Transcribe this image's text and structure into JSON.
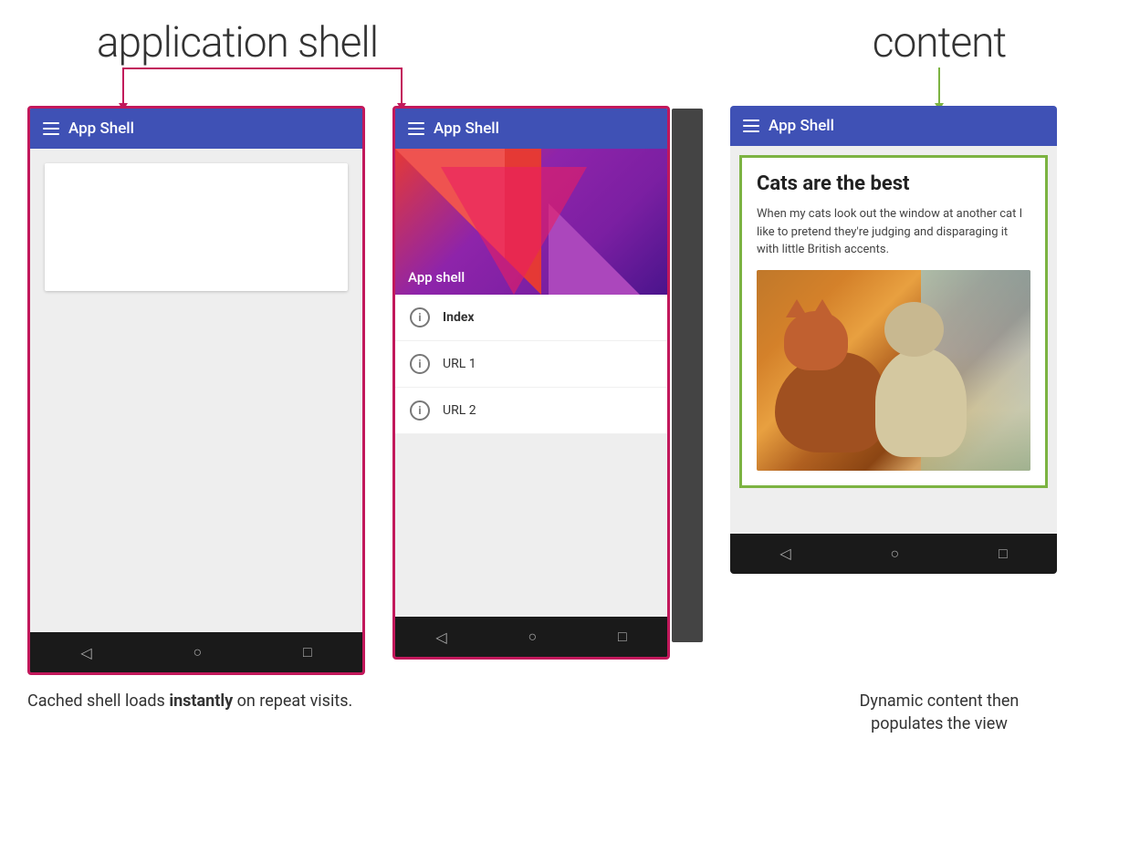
{
  "labels": {
    "application_shell": "application shell",
    "content": "content"
  },
  "phones": {
    "first": {
      "title": "App Shell",
      "placeholder": "content placeholder"
    },
    "second": {
      "title": "App Shell",
      "drawer_app_label": "App shell",
      "menu_items": [
        {
          "label": "Index",
          "bold": true
        },
        {
          "label": "URL 1",
          "bold": false
        },
        {
          "label": "URL 2",
          "bold": false
        }
      ]
    },
    "third": {
      "title": "App Shell",
      "article": {
        "title": "Cats are the best",
        "text": "When my cats look out the window at another cat I like to pretend they're judging and disparaging it with little British accents."
      }
    }
  },
  "nav": {
    "back": "◁",
    "home": "○",
    "recent": "□"
  },
  "captions": {
    "left": "Cached shell loads instantly on repeat visits.",
    "left_bold": "instantly",
    "right_line1": "Dynamic content then",
    "right_line2": "populates the view"
  }
}
